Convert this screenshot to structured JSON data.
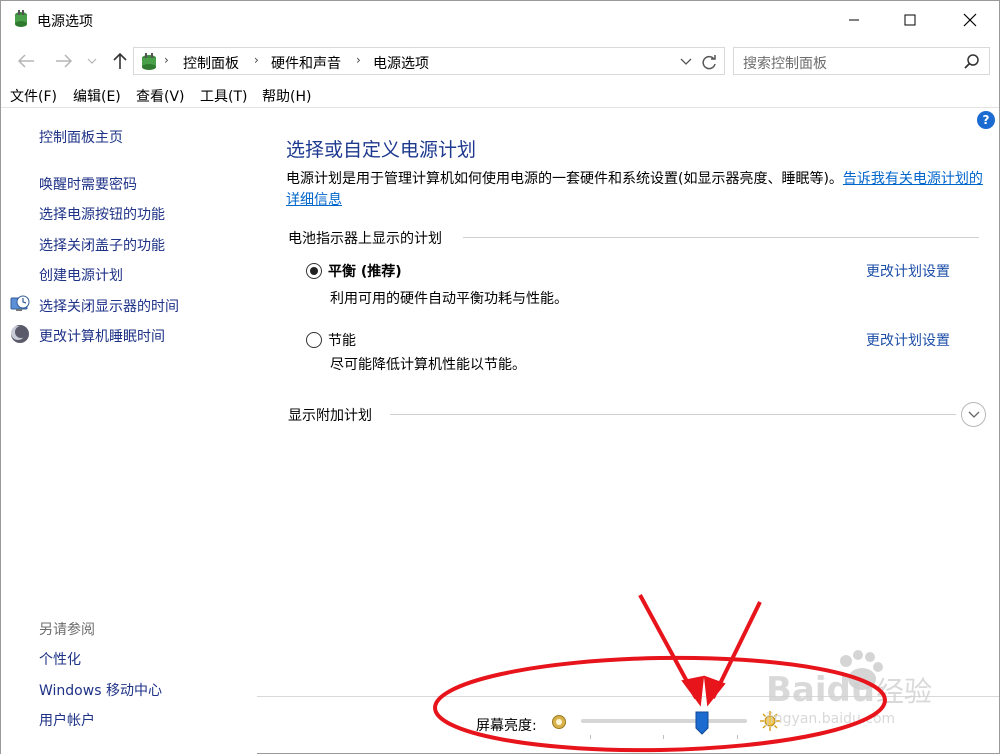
{
  "window": {
    "title": "电源选项",
    "controls": [
      "minimize",
      "maximize",
      "close"
    ]
  },
  "address_bar": {
    "breadcrumbs": [
      "控制面板",
      "硬件和声音",
      "电源选项"
    ],
    "search_placeholder": "搜索控制面板"
  },
  "menu": {
    "items": [
      "文件(F)",
      "编辑(E)",
      "查看(V)",
      "工具(T)",
      "帮助(H)"
    ]
  },
  "sidebar": {
    "home": "控制面板主页",
    "links": [
      {
        "label": "唤醒时需要密码",
        "icon": ""
      },
      {
        "label": "选择电源按钮的功能",
        "icon": ""
      },
      {
        "label": "选择关闭盖子的功能",
        "icon": ""
      },
      {
        "label": "创建电源计划",
        "icon": ""
      },
      {
        "label": "选择关闭显示器的时间",
        "icon": "monitor-clock-icon"
      },
      {
        "label": "更改计算机睡眠时间",
        "icon": "moon-icon"
      }
    ],
    "see_also_title": "另请参阅",
    "see_also": [
      "个性化",
      "Windows 移动中心",
      "用户帐户"
    ]
  },
  "main": {
    "title": "选择或自定义电源计划",
    "description": "电源计划是用于管理计算机如何使用电源的一套硬件和系统设置(如显示器亮度、睡眠等)。",
    "description_link": "告诉我有关电源计划的详细信息",
    "section_label": "电池指示器上显示的计划",
    "plans": [
      {
        "name": "平衡 (推荐)",
        "description": "利用可用的硬件自动平衡功耗与性能。",
        "selected": true,
        "change_link": "更改计划设置"
      },
      {
        "name": "节能",
        "description": "尽可能降低计算机性能以节能。",
        "selected": false,
        "change_link": "更改计划设置"
      }
    ],
    "more_plans_label": "显示附加计划"
  },
  "brightness": {
    "label": "屏幕亮度:",
    "level_fraction": 0.73
  },
  "watermark": {
    "text": "Baidu 经验",
    "subtext": "jingyan.baidu.com"
  },
  "colors": {
    "link": "#1e3287",
    "title": "#1e3a8f",
    "annotation": "#e8141b",
    "slider_thumb": "#1c6bd0"
  }
}
